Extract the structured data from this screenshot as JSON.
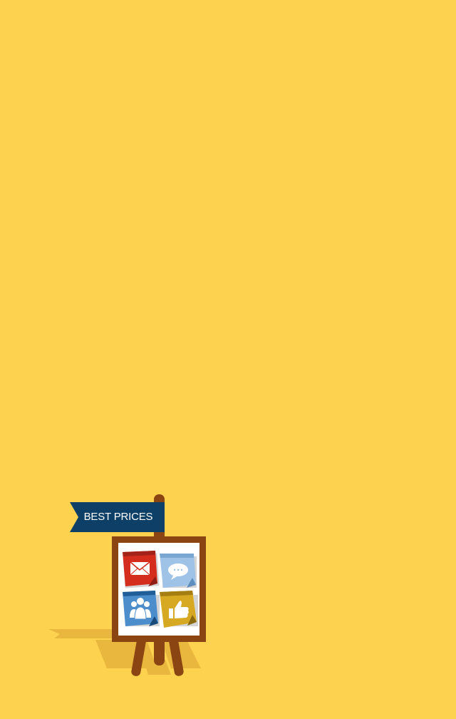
{
  "background_color": "#FDD24F",
  "signboard": {
    "flag_label": "BEST PRICES",
    "flag_color": "#0E3F67",
    "frame_color": "#8B4513",
    "board_color": "#FFFFFF",
    "icons": [
      {
        "name": "mail-icon",
        "color": "#D42D1E"
      },
      {
        "name": "chat-bubble-icon",
        "color": "#9FC3E7"
      },
      {
        "name": "people-icon",
        "color": "#4C8ECC"
      },
      {
        "name": "thumbs-up-icon",
        "color": "#D7A923"
      }
    ]
  }
}
